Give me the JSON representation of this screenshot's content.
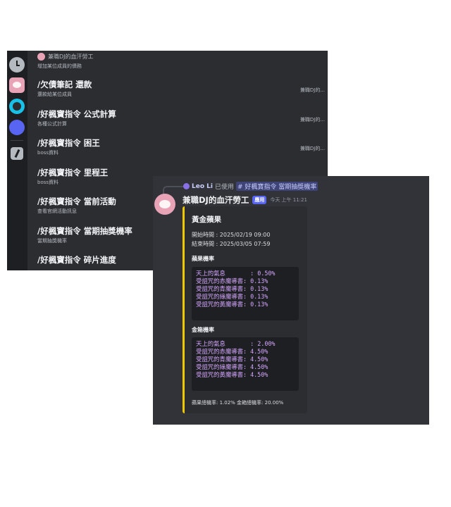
{
  "command_panel": {
    "top_item": {
      "bot_name": "兼職DJ的血汗勞工",
      "description": "增加某位成員的債務"
    },
    "items": [
      {
        "name": "/欠債筆記 還款",
        "description": "還款給某位成員",
        "source": "兼職DJ的..."
      },
      {
        "name": "/好楓寶指令 公式計算",
        "description": "各種公式計算",
        "source": "兼職DJ的..."
      },
      {
        "name": "/好楓寶指令 困王",
        "description": "boss資料",
        "source": "兼職DJ的..."
      },
      {
        "name": "/好楓寶指令 里程王",
        "description": "boss資料",
        "source": ""
      },
      {
        "name": "/好楓寶指令 當前活動",
        "description": "查看官網活動訊息",
        "source": ""
      },
      {
        "name": "/好楓寶指令 當期抽獎機率",
        "description": "當期抽獎機率",
        "source": ""
      },
      {
        "name": "/好楓寶指令 碎片進度",
        "description": "",
        "source": ""
      }
    ],
    "rail_icons": [
      "clock-icon",
      "server-avatar",
      "bot-icon",
      "blue-circle",
      "slash-command-icon"
    ]
  },
  "message": {
    "reply": {
      "user": "Leo Li",
      "action": "已使用",
      "command": "# 好楓寶指令 當期抽獎機率"
    },
    "author": "兼職DJ的血汗勞工",
    "badge": "應用",
    "timestamp": "今天 上午 11:21",
    "embed": {
      "accent_color": "#f0c800",
      "title": "黃金蘋果",
      "start_time": "開始時間 : 2025/02/19 09:00",
      "end_time": "結束時間 : 2025/03/05 07:59",
      "fields": [
        {
          "name": "蘋果機率",
          "lines": [
            "天上的氣息       : 0.50%",
            "受詛咒的赤魔導書: 0.13%",
            "受詛咒的青魔導書: 0.13%",
            "受詛咒的綠魔導書: 0.13%",
            "受詛咒的黃魔導書: 0.13%"
          ]
        },
        {
          "name": "金箱機率",
          "lines": [
            "天上的氣息       : 2.00%",
            "受詛咒的赤魔導書: 4.50%",
            "受詛咒的青魔導書: 4.50%",
            "受詛咒的綠魔導書: 4.50%",
            "受詛咒的黃魔導書: 4.50%"
          ]
        }
      ],
      "footer": "蘋果總機率: 1.02% 金箱總機率: 20.00%"
    }
  }
}
